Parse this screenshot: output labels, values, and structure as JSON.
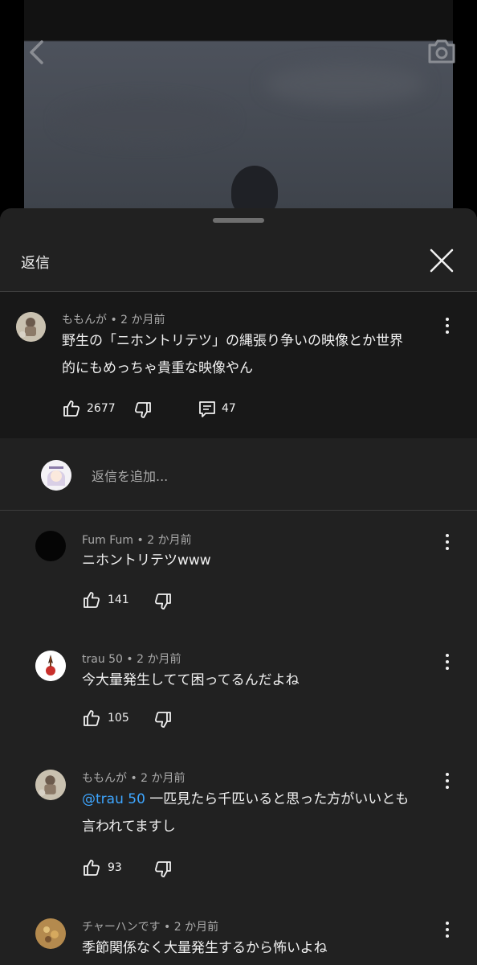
{
  "header": {
    "title": "返信"
  },
  "parent_comment": {
    "author": "ももんが",
    "age": "2 か月前",
    "text_line1": "野生の「ニホントリテツ」の縄張り争いの映像とか世界",
    "text_line2": "的にもめっちゃ貴重な映像やん",
    "likes": "2677",
    "replies": "47"
  },
  "reply_box": {
    "placeholder": "返信を追加..."
  },
  "replies": [
    {
      "author": "Fum Fum",
      "age": "2 か月前",
      "text_line1": "ニホントリテツwww",
      "likes": "141"
    },
    {
      "author": "trau 50",
      "age": "2 か月前",
      "text_line1": "今大量発生してて困ってるんだよね",
      "likes": "105"
    },
    {
      "author": "ももんが",
      "age": "2 か月前",
      "mention": "@trau 50",
      "text_line1": " 一匹見たら千匹いると思った方がいいとも",
      "text_line2": "言われてますし",
      "likes": "93"
    },
    {
      "author": "チャーハンです",
      "age": "2 か月前",
      "text_line1": "季節関係なく大量発生するから怖いよね"
    }
  ],
  "separator": " • ",
  "icons": [
    "back-icon",
    "camera-icon",
    "close-icon",
    "like-icon",
    "dislike-icon",
    "reply-icon",
    "more-icon"
  ],
  "colors": {
    "sheet_bg": "#212121",
    "parent_bg": "#181818",
    "mention": "#3ea6ff",
    "meta": "#aaaaaa"
  }
}
